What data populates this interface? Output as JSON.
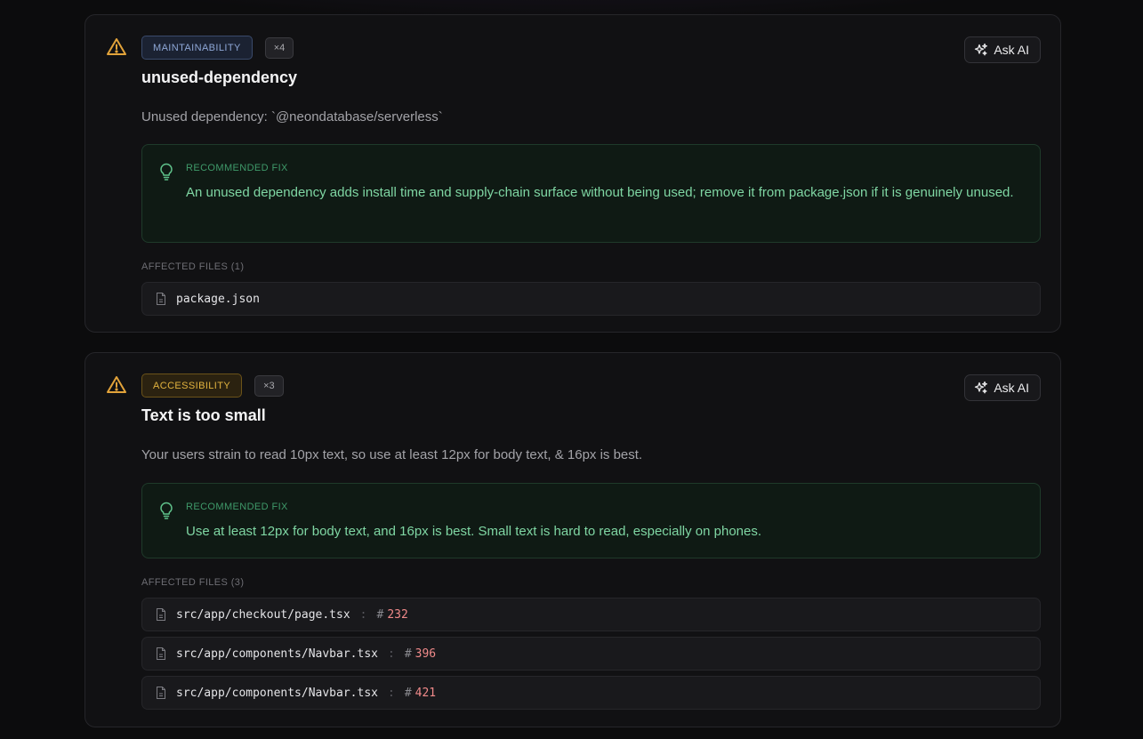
{
  "issues": [
    {
      "category": "MAINTAINABILITY",
      "count": "×4",
      "ask_label": "Ask AI",
      "title": "unused-dependency",
      "description": "Unused dependency: `@neondatabase/serverless`",
      "fix_label": "RECOMMENDED FIX",
      "fix_text": "An unused dependency adds install time and supply-chain surface without being used; remove it from package.json if it is genuinely unused.",
      "files_label": "AFFECTED FILES (1)",
      "files": [
        {
          "path": "package.json"
        }
      ]
    },
    {
      "category": "ACCESSIBILITY",
      "count": "×3",
      "ask_label": "Ask AI",
      "title": "Text is too small",
      "description": "Your users strain to read 10px text, so use at least 12px for body text, & 16px is best.",
      "fix_label": "RECOMMENDED FIX",
      "fix_text": "Use at least 12px for body text, and 16px is best. Small text is hard to read, especially on phones.",
      "files_label": "AFFECTED FILES (3)",
      "files": [
        {
          "path": "src/app/checkout/page.tsx",
          "sep": ":",
          "hash": "#",
          "line": "232"
        },
        {
          "path": "src/app/components/Navbar.tsx",
          "sep": ":",
          "hash": "#",
          "line": "396"
        },
        {
          "path": "src/app/components/Navbar.tsx",
          "sep": ":",
          "hash": "#",
          "line": "421"
        }
      ]
    }
  ],
  "colors": {
    "warning": "#e2a33a",
    "maintainability": "#8ea7d6",
    "accessibility": "#e2b33f",
    "fix_text": "#7fd6a3",
    "line_number": "#f08a8a"
  },
  "icons": {
    "severity": "warning-triangle-icon",
    "ask": "sparkles-icon",
    "fix": "lightbulb-icon",
    "file": "file-icon"
  }
}
